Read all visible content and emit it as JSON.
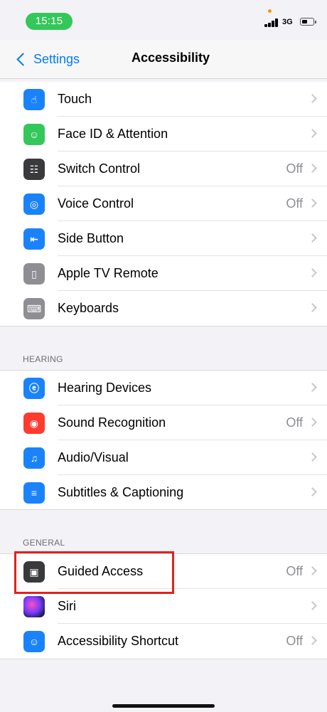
{
  "status_bar": {
    "time": "15:15",
    "network": "3G"
  },
  "nav": {
    "back_label": "Settings",
    "title": "Accessibility"
  },
  "groups": {
    "physical": [
      {
        "label": "Touch",
        "value": "",
        "icon": "hand-icon",
        "color": "#1a82fb"
      },
      {
        "label": "Face ID & Attention",
        "value": "",
        "icon": "face-id-icon",
        "color": "#34c759"
      },
      {
        "label": "Switch Control",
        "value": "Off",
        "icon": "switch-control-icon",
        "color": "#3a3a3c"
      },
      {
        "label": "Voice Control",
        "value": "Off",
        "icon": "voice-control-icon",
        "color": "#1a82fb"
      },
      {
        "label": "Side Button",
        "value": "",
        "icon": "side-button-icon",
        "color": "#1a82fb"
      },
      {
        "label": "Apple TV Remote",
        "value": "",
        "icon": "tv-remote-icon",
        "color": "#8e8e93"
      },
      {
        "label": "Keyboards",
        "value": "",
        "icon": "keyboard-icon",
        "color": "#8e8e93"
      }
    ],
    "hearing": {
      "header": "HEARING",
      "items": [
        {
          "label": "Hearing Devices",
          "value": "",
          "icon": "ear-icon",
          "color": "#1a82fb"
        },
        {
          "label": "Sound Recognition",
          "value": "Off",
          "icon": "sound-recognition-icon",
          "color": "#ff3b30"
        },
        {
          "label": "Audio/Visual",
          "value": "",
          "icon": "speaker-icon",
          "color": "#1a82fb"
        },
        {
          "label": "Subtitles & Captioning",
          "value": "",
          "icon": "captions-icon",
          "color": "#1a82fb"
        }
      ]
    },
    "general": {
      "header": "GENERAL",
      "items": [
        {
          "label": "Guided Access",
          "value": "Off",
          "icon": "lock-icon",
          "color": "#3a3a3c"
        },
        {
          "label": "Siri",
          "value": "",
          "icon": "siri-icon",
          "color": "#2c2c8e"
        },
        {
          "label": "Accessibility Shortcut",
          "value": "Off",
          "icon": "accessibility-icon",
          "color": "#1a82fb"
        }
      ]
    }
  },
  "colors": {
    "accent": "#007aff",
    "highlight": "#e3211c",
    "time_pill": "#34c759"
  }
}
